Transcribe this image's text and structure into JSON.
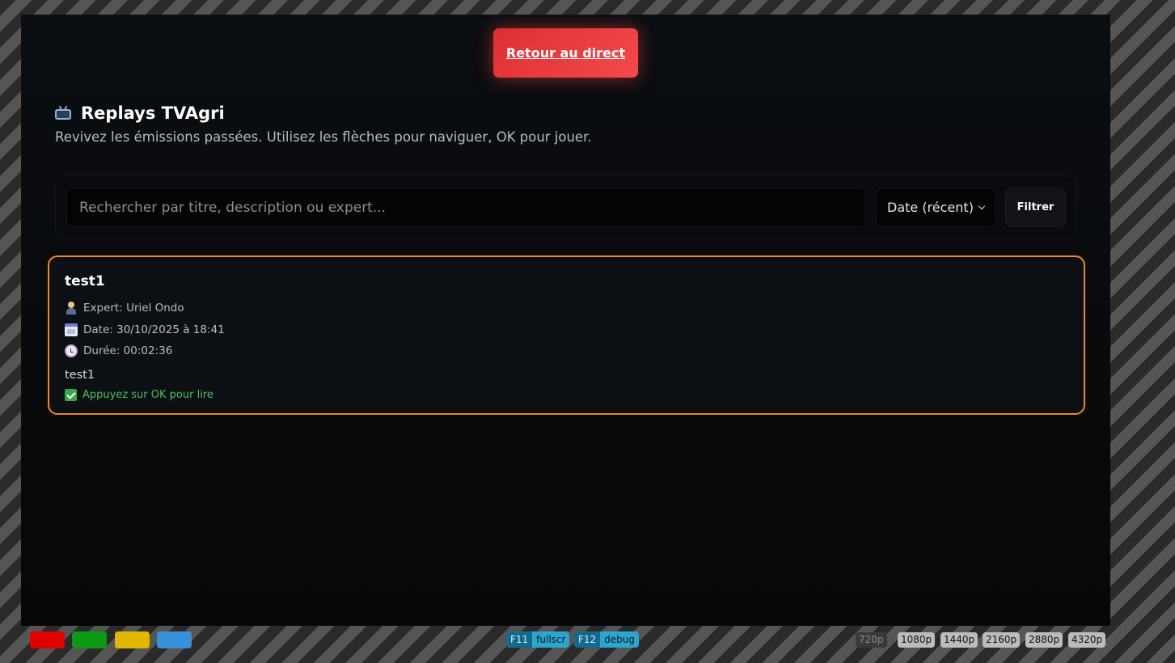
{
  "live_button": {
    "label": "Retour au direct"
  },
  "header": {
    "icon": "tv-icon",
    "title": "Replays TVAgri",
    "subtitle": "Revivez les émissions passées. Utilisez les flèches pour naviguer, OK pour jouer."
  },
  "filters": {
    "search_placeholder": "Rechercher par titre, description ou expert...",
    "search_value": "",
    "sort_selected": "Date (récent)",
    "filter_label": "Filtrer"
  },
  "replays": [
    {
      "title": "test1",
      "expert": "Expert: Uriel Ondo",
      "date": "Date: 30/10/2025 à 18:41",
      "duration": "Durée: 00:02:36",
      "description": "test1",
      "hint": "Appuyez sur OK pour lire"
    }
  ],
  "emulator": {
    "color_keys": [
      {
        "name": "red",
        "color": "#e00000"
      },
      {
        "name": "green",
        "color": "#0a9a16"
      },
      {
        "name": "yellow",
        "color": "#e0b800"
      },
      {
        "name": "blue",
        "color": "#3a90d8"
      }
    ],
    "function_keys": [
      {
        "key": "F11",
        "label": "fullscr"
      },
      {
        "key": "F12",
        "label": "debug"
      }
    ],
    "resolutions": [
      "720p",
      "1080p",
      "1440p",
      "2160p",
      "2880p",
      "4320p"
    ],
    "active_resolution": "720p"
  },
  "colors": {
    "accent_live": "#e8383c",
    "focus_border": "#f08a1a",
    "hint_green": "#4fbf5a"
  }
}
